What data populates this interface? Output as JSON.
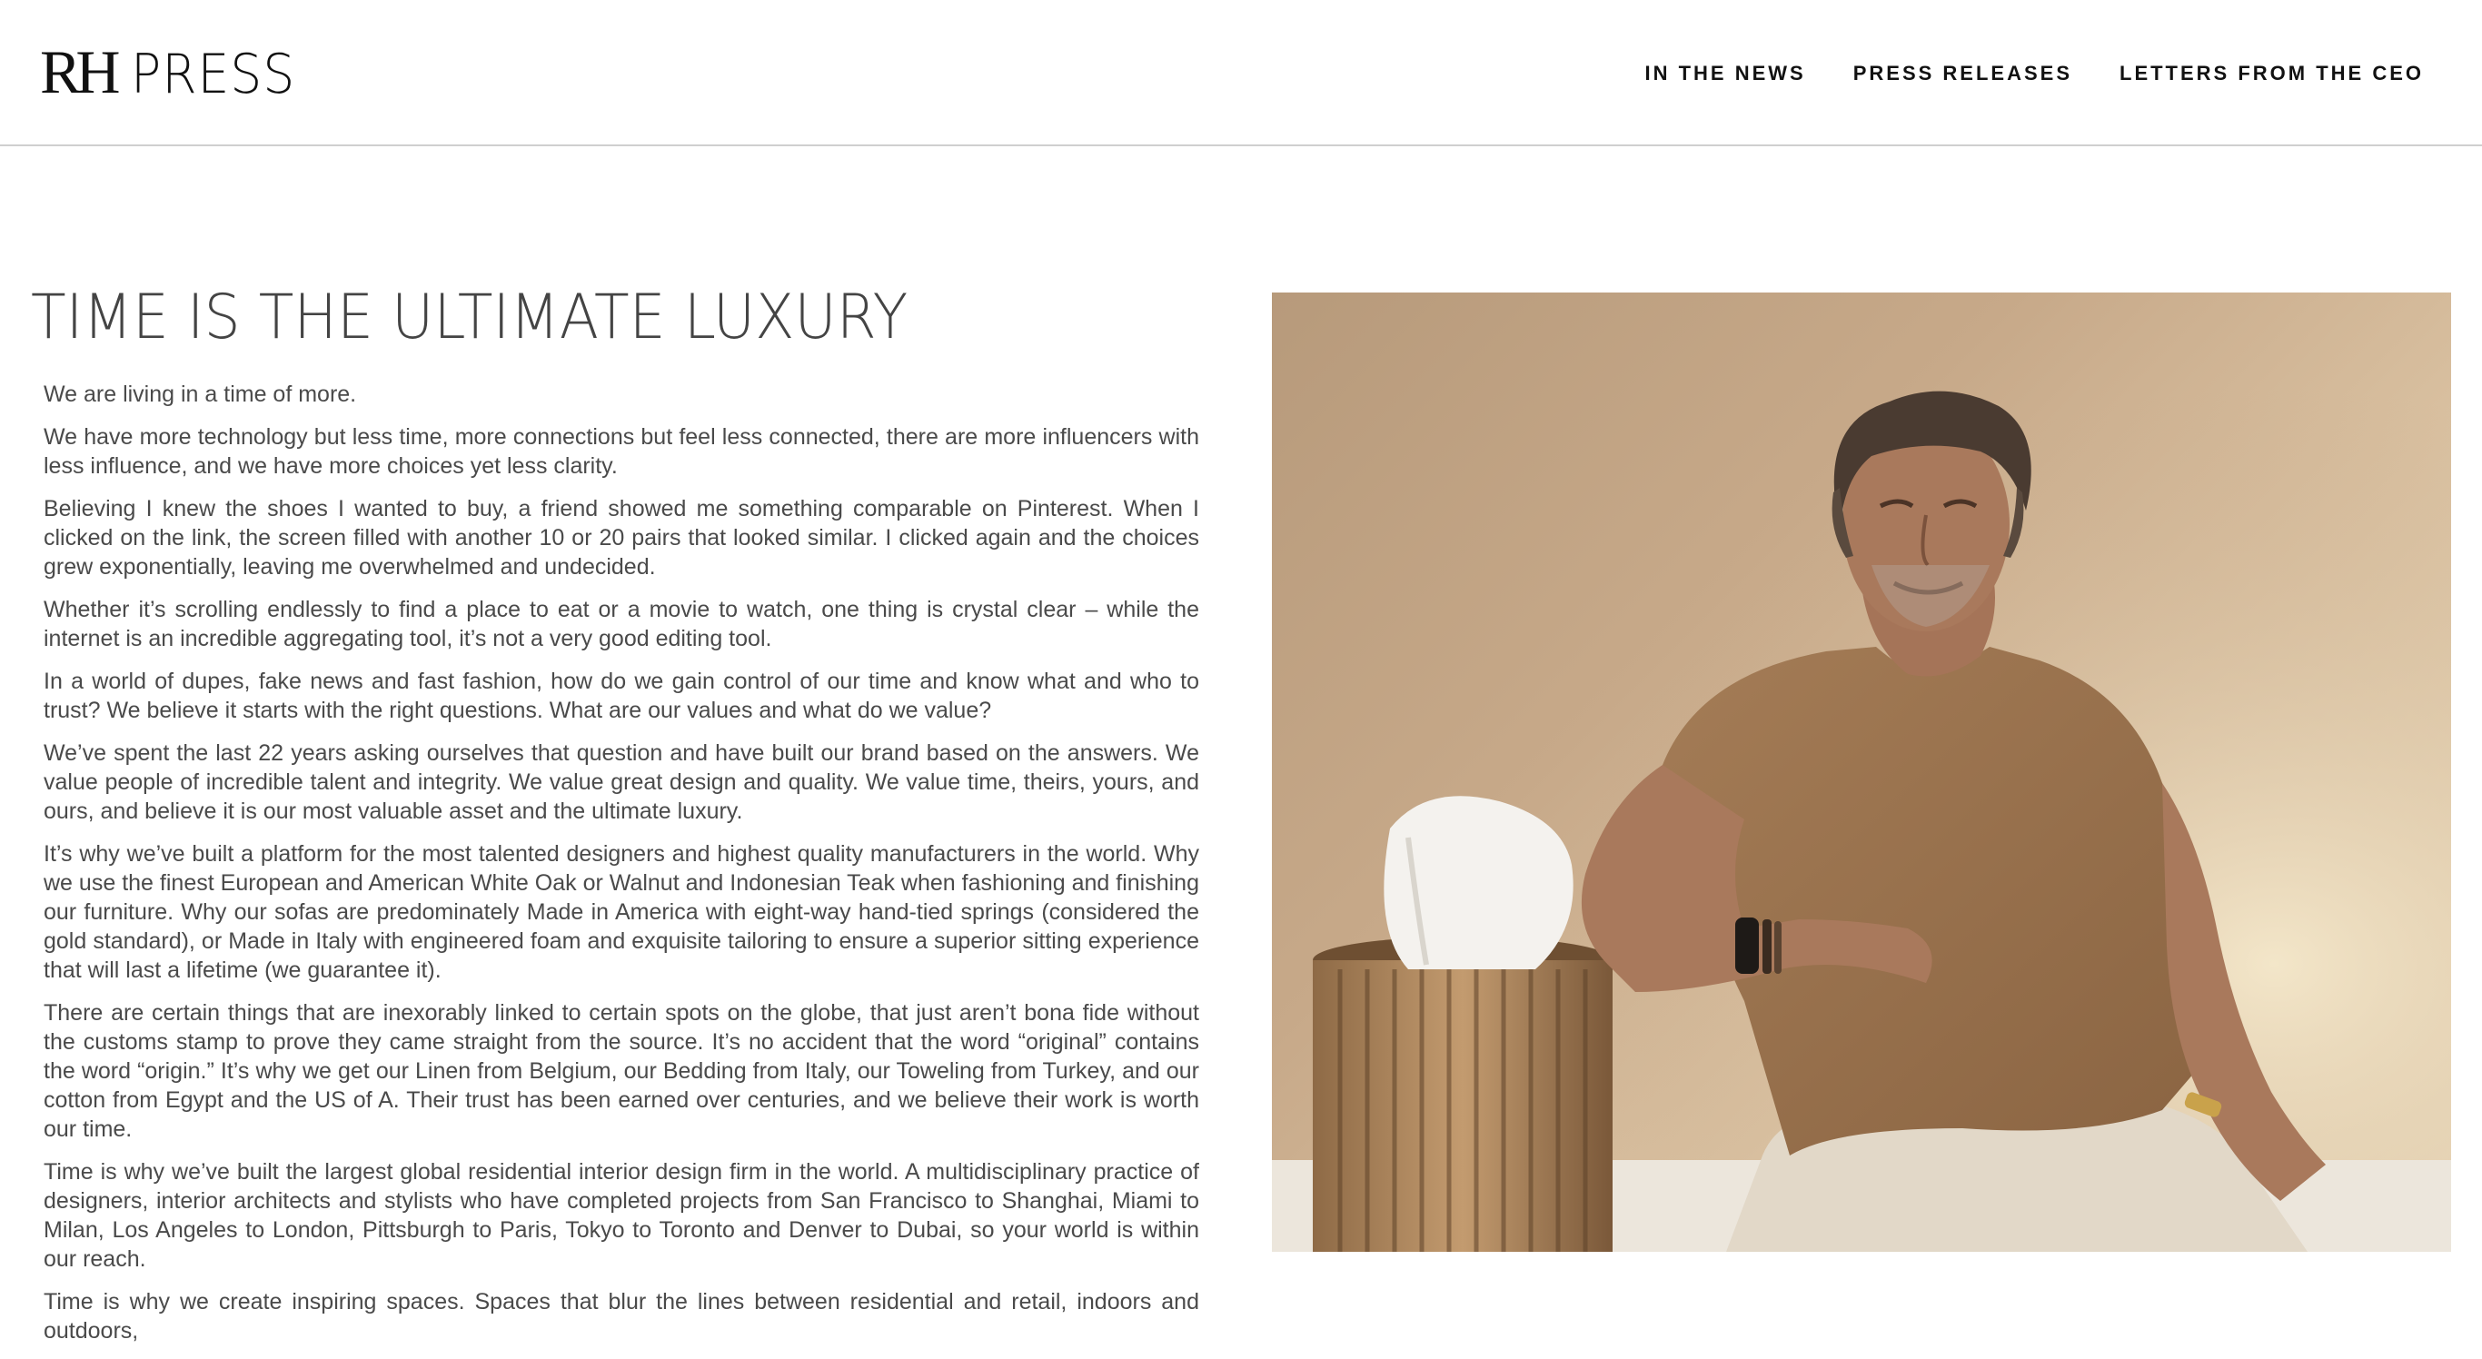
{
  "header": {
    "logo_rh": "RH",
    "logo_press": "PRESS",
    "nav": [
      {
        "label": "IN THE NEWS"
      },
      {
        "label": "PRESS RELEASES"
      },
      {
        "label": "LETTERS FROM THE CEO"
      }
    ]
  },
  "article": {
    "title": "TIME IS THE ULTIMATE LUXURY",
    "paragraphs": [
      "We are living in a time of more.",
      "We have more technology but less time, more connections but feel less connected, there are more influencers with less influence, and we have more choices yet less clarity.",
      "Believing I knew the shoes I wanted to buy, a friend showed me something comparable on Pinterest. When I clicked on the link, the screen filled with another 10 or 20 pairs that looked similar. I clicked again and the choices grew exponentially, leaving me overwhelmed and undecided.",
      "Whether it’s scrolling endlessly to find a place to eat or a movie to watch, one thing is crystal clear – while the internet is an incredible aggregating tool, it’s not a very good editing tool.",
      "In a world of dupes, fake news and fast fashion, how do we gain control of our time and know what and who to trust? We believe it starts with the right questions. What are our values and what do we value?",
      "We’ve spent the last 22 years asking ourselves that question and have built our brand based on the answers. We value people of incredible talent and integrity. We value great design and quality. We value time, theirs, yours, and ours, and believe it is our most valuable asset and the ultimate luxury.",
      "It’s why we’ve built a platform for the most talented designers and highest quality manufacturers in the world. Why we use the finest European and American White Oak or Walnut and Indonesian Teak when fashioning and finishing our furniture. Why our sofas are predominately Made in America with eight-way hand-tied springs (considered the gold standard), or Made in Italy with engineered foam and exquisite tailoring to ensure a superior sitting experience that will last a lifetime (we guarantee it).",
      "There are certain things that are inexorably linked to certain spots on the globe, that just aren’t bona fide without the customs stamp to prove they came straight from the source. It’s no accident that the word “original” contains the word “origin.” It’s why we get our Linen from Belgium, our Bedding from Italy, our Toweling from Turkey, and our cotton from Egypt and the US of A. Their trust has been earned over centuries, and we believe their work is worth our time.",
      "Time is why we’ve built the largest global residential interior design firm in the world. A multidisciplinary practice of designers, interior architects and stylists who have completed projects from San Francisco to Shanghai, Miami to Milan, Los Angeles to London, Pittsburgh to Paris, Tokyo to Toronto and Denver to Dubai, so your world is within our reach.",
      "Time is why we create inspiring spaces. Spaces that blur the lines between residential and retail, indoors and outdoors,"
    ]
  },
  "photo": {
    "colors": {
      "backdrop": "#c9ab8b",
      "shirt": "#9c7550",
      "skin": "#a9795c",
      "hair": "#4a3b31",
      "pants": "#e2d8c8",
      "pillow": "#f4f2ee",
      "stool": "#b08962"
    }
  }
}
